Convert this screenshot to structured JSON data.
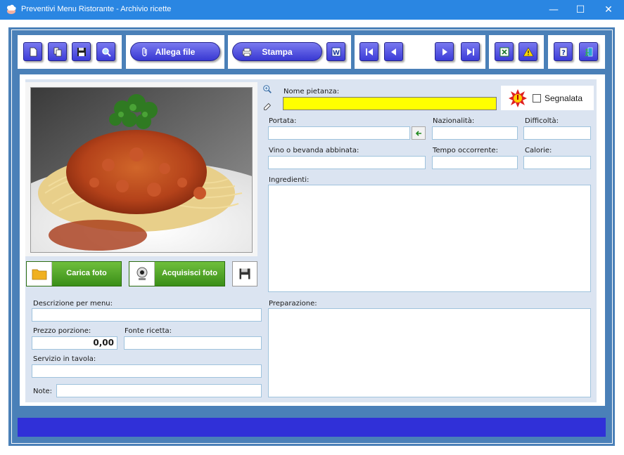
{
  "window": {
    "title": "Preventivi Menu Ristorante - Archivio ricette",
    "minimize": "—",
    "maximize": "☐",
    "close": "✕"
  },
  "toolbar": {
    "attach_label": "Allega file",
    "print_label": "Stampa"
  },
  "photo": {
    "load_label": "Carica foto",
    "acquire_label": "Acquisisci foto"
  },
  "form": {
    "nome_pietanza_label": "Nome pietanza:",
    "nome_pietanza_value": "",
    "segnalata_label": "Segnalata",
    "portata_label": "Portata:",
    "nazionalita_label": "Nazionalità:",
    "difficolta_label": "Difficoltà:",
    "vino_label": "Vino o bevanda abbinata:",
    "tempo_label": "Tempo occorrente:",
    "calorie_label": "Calorie:",
    "ingredienti_label": "Ingredienti:",
    "descrizione_label": "Descrizione per menu:",
    "prezzo_label": "Prezzo porzione:",
    "prezzo_value": "0,00",
    "fonte_label": "Fonte ricetta:",
    "servizio_label": "Servizio in tavola:",
    "preparazione_label": "Preparazione:",
    "note_label": "Note:"
  },
  "colors": {
    "titlebar": "#2a86e2",
    "frame": "#4a80b8",
    "button_blue": "#3c3cd8",
    "button_green": "#3a8e18",
    "highlight_field": "#ffff00",
    "status_bar": "#3030d8"
  }
}
